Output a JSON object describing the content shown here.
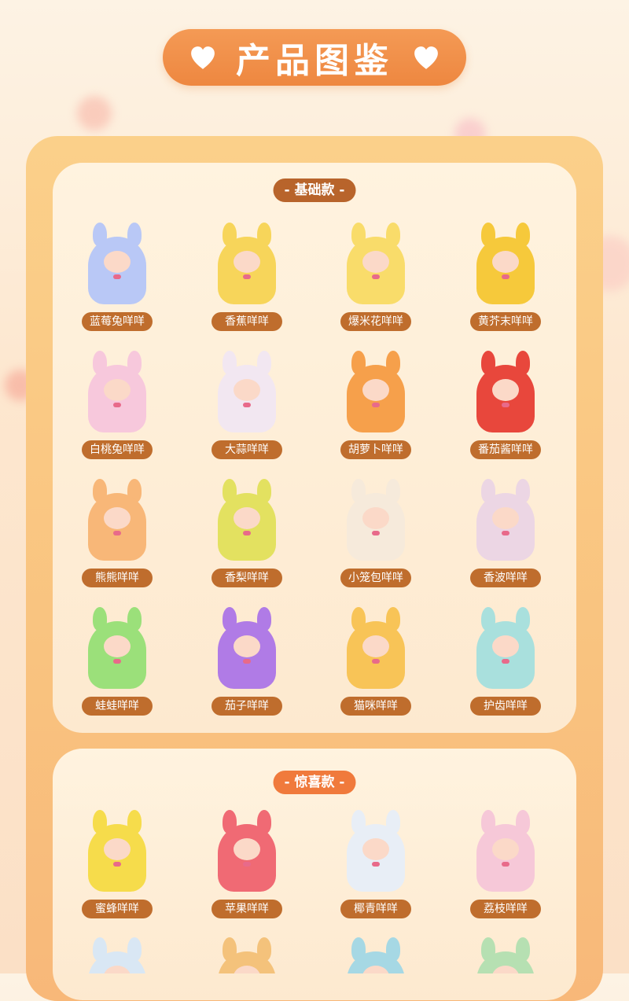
{
  "header": {
    "title": "产品图鉴"
  },
  "basic": {
    "tag": "- 基础款 -",
    "items": [
      {
        "label": "蓝莓兔咩咩",
        "color": "#b9c8f6"
      },
      {
        "label": "香蕉咩咩",
        "color": "#f7d55a"
      },
      {
        "label": "爆米花咩咩",
        "color": "#f9dc6a"
      },
      {
        "label": "黄芥末咩咩",
        "color": "#f6c93b"
      },
      {
        "label": "白桃兔咩咩",
        "color": "#f7c8dc"
      },
      {
        "label": "大蒜咩咩",
        "color": "#f2e7f1"
      },
      {
        "label": "胡萝卜咩咩",
        "color": "#f6a04b"
      },
      {
        "label": "番茄酱咩咩",
        "color": "#e8473c"
      },
      {
        "label": "熊熊咩咩",
        "color": "#f8b778"
      },
      {
        "label": "香梨咩咩",
        "color": "#e3e160"
      },
      {
        "label": "小笼包咩咩",
        "color": "#f6eadb"
      },
      {
        "label": "香波咩咩",
        "color": "#ecd6e4"
      },
      {
        "label": "蛙蛙咩咩",
        "color": "#9be07a"
      },
      {
        "label": "茄子咩咩",
        "color": "#b07be6"
      },
      {
        "label": "猫咪咩咩",
        "color": "#f8c457"
      },
      {
        "label": "护齿咩咩",
        "color": "#a9e0dd"
      }
    ]
  },
  "surprise": {
    "tag": "- 惊喜款 -",
    "items": [
      {
        "label": "蜜蜂咩咩",
        "color": "#f6dc4b"
      },
      {
        "label": "苹果咩咩",
        "color": "#f06a74"
      },
      {
        "label": "椰青咩咩",
        "color": "#e8eef6"
      },
      {
        "label": "荔枝咩咩",
        "color": "#f6c8d8"
      }
    ],
    "partial": [
      {
        "color": "#d9e7f4"
      },
      {
        "color": "#f4c27b"
      },
      {
        "color": "#a6d8e4"
      },
      {
        "color": "#b6e0b2"
      }
    ]
  },
  "colors": {
    "header_pill": "#ee8740",
    "tag_basic": "#b8642b",
    "tag_surprise": "#f07a3c",
    "label_bg": "#bf6d2d"
  }
}
